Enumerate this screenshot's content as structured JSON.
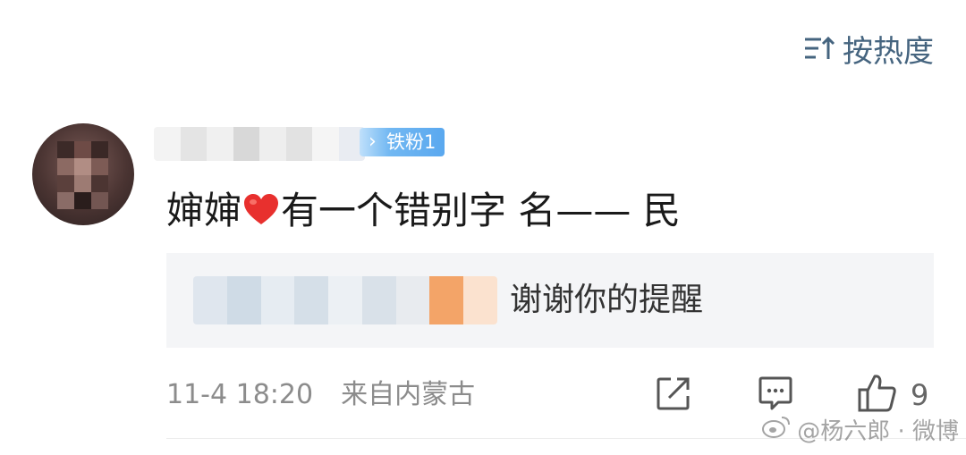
{
  "sort": {
    "label": "按热度",
    "icon": "sort-icon",
    "color": "#45647f"
  },
  "comment": {
    "avatar_icon": "blurred-avatar",
    "badge": "铁粉1",
    "text_before": "婶婶",
    "emoji": "heart-icon",
    "text_after": "有一个错别字 名—— 民",
    "reply": {
      "text": "谢谢你的提醒"
    },
    "time": "11-4 18:20",
    "location": "来自内蒙古",
    "likes": "9"
  },
  "actions": {
    "share_icon": "share-icon",
    "comment_icon": "comment-icon",
    "like_icon": "thumbs-up-icon"
  },
  "watermark": {
    "text": "@杨六郎 · 微博",
    "icon": "weibo-logo"
  },
  "colors": {
    "badge": "#5aa8ef",
    "heart": "#e8302e",
    "meta": "#8c8c8c"
  }
}
